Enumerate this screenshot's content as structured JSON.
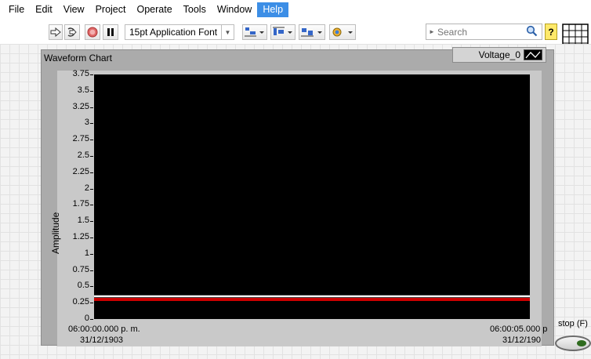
{
  "menu": {
    "items": [
      {
        "label": "File"
      },
      {
        "label": "Edit"
      },
      {
        "label": "View"
      },
      {
        "label": "Project"
      },
      {
        "label": "Operate"
      },
      {
        "label": "Tools"
      },
      {
        "label": "Window"
      },
      {
        "label": "Help",
        "active": true
      }
    ]
  },
  "toolbar": {
    "font_selector": "15pt Application Font",
    "search_placeholder": "Search"
  },
  "chart": {
    "title": "Waveform Chart",
    "legend_label": "Voltage_0",
    "y_axis_title": "Amplitude",
    "y_ticks": [
      "3.75",
      "3.5",
      "3.25",
      "3",
      "2.75",
      "2.5",
      "2.25",
      "2",
      "1.75",
      "1.5",
      "1.25",
      "1",
      "0.75",
      "0.5",
      "0.25",
      "0"
    ],
    "x_start_time": "06:00:00.000 p. m.",
    "x_start_date": "31/12/1903",
    "x_end_time": "06:00:05.000 p",
    "x_end_date": "31/12/190",
    "colors": {
      "plot_bg": "#000000",
      "trace_white": "#ffffff",
      "trace_red": "#cc0000"
    }
  },
  "chart_data": {
    "type": "line",
    "title": "Waveform Chart",
    "xlabel": "",
    "ylabel": "Amplitude",
    "ylim": [
      0,
      3.75
    ],
    "x": [
      "06:00:00.000 p. m.",
      "06:00:05.000 p"
    ],
    "series": [
      {
        "name": "Voltage_0",
        "values": [
          0.3,
          0.3
        ]
      }
    ],
    "legend": "top-right",
    "grid": false
  },
  "stop": {
    "label": "stop (F)"
  }
}
